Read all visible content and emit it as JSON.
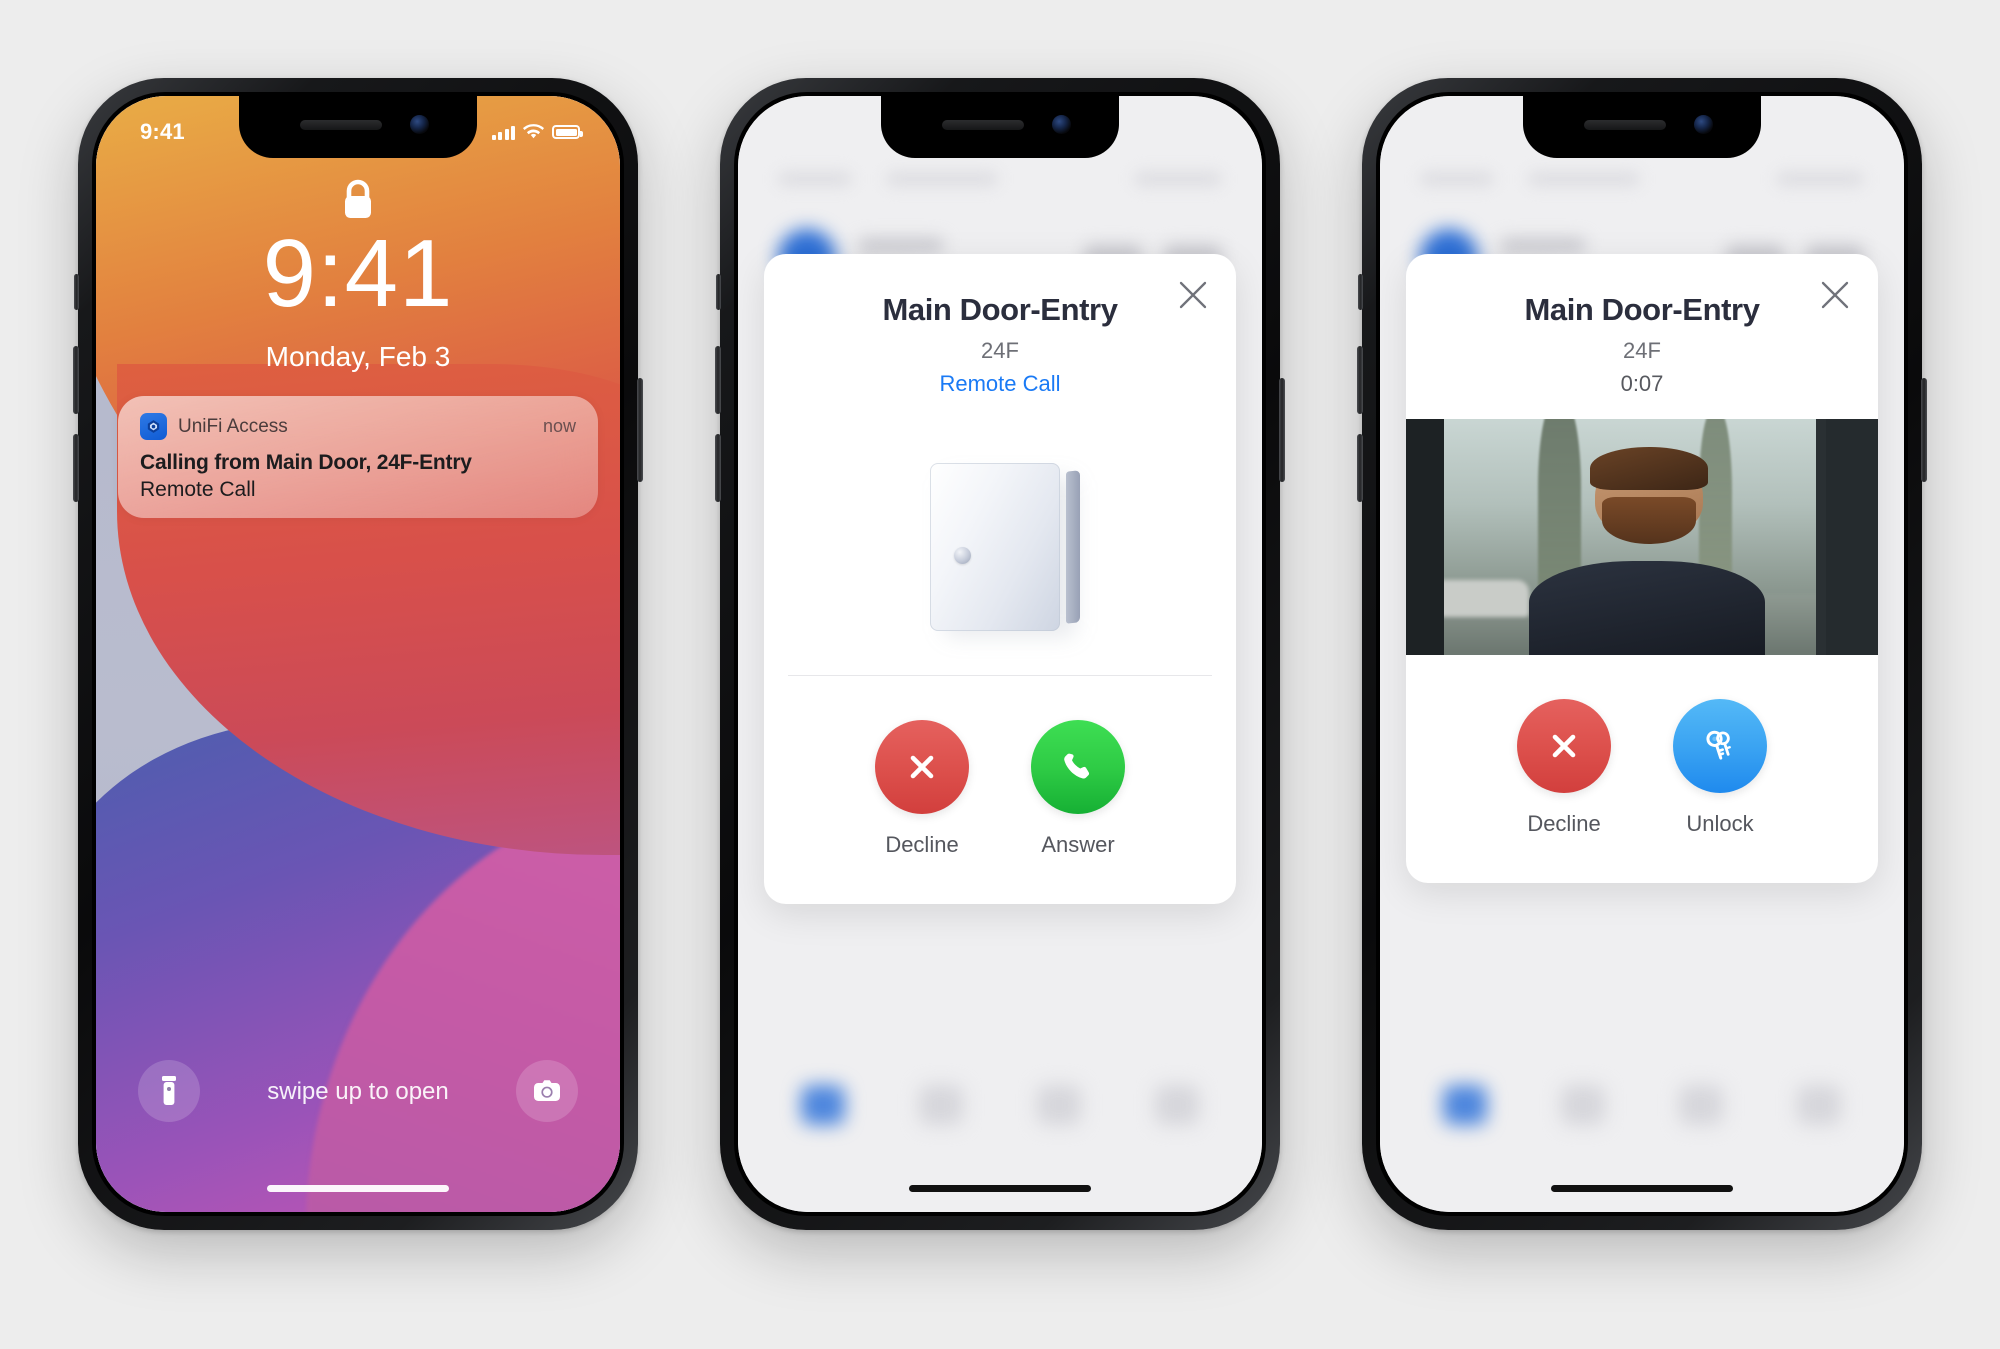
{
  "colors": {
    "decline": "#dc4f4b",
    "answer": "#2ecb45",
    "unlock": "#3aa3f2",
    "link": "#1a7af5",
    "page_bg": "#ededed"
  },
  "phone_lockscreen": {
    "status_bar": {
      "time": "9:41",
      "signal_icon": "cellular-bars-icon",
      "wifi_icon": "wifi-icon",
      "battery_icon": "battery-full-icon"
    },
    "lock_icon": "lock-icon",
    "clock": "9:41",
    "date": "Monday, Feb 3",
    "notification": {
      "app_icon": "unifi-access-app-icon",
      "app_name": "UniFi Access",
      "timestamp": "now",
      "title": "Calling from Main Door, 24F-Entry",
      "subtitle": "Remote Call"
    },
    "bottom": {
      "flashlight_icon": "flashlight-icon",
      "camera_icon": "camera-icon",
      "swipe_hint": "swipe up to open"
    }
  },
  "phone_incoming_call": {
    "modal": {
      "close_icon": "close-icon",
      "title": "Main Door-Entry",
      "subtitle": "24F",
      "status": "Remote Call",
      "preview_icon": "door-reader-image",
      "actions": [
        {
          "id": "decline",
          "label": "Decline",
          "icon": "x-icon",
          "color": "#dc4f4b"
        },
        {
          "id": "answer",
          "label": "Answer",
          "icon": "phone-icon",
          "color": "#2ecb45"
        }
      ]
    }
  },
  "phone_active_call": {
    "modal": {
      "close_icon": "close-icon",
      "title": "Main Door-Entry",
      "subtitle": "24F",
      "status": "0:07",
      "preview_icon": "camera-video-feed",
      "actions": [
        {
          "id": "decline",
          "label": "Decline",
          "icon": "x-icon",
          "color": "#dc4f4b"
        },
        {
          "id": "unlock",
          "label": "Unlock",
          "icon": "keys-icon",
          "color": "#3aa3f2"
        }
      ]
    }
  }
}
